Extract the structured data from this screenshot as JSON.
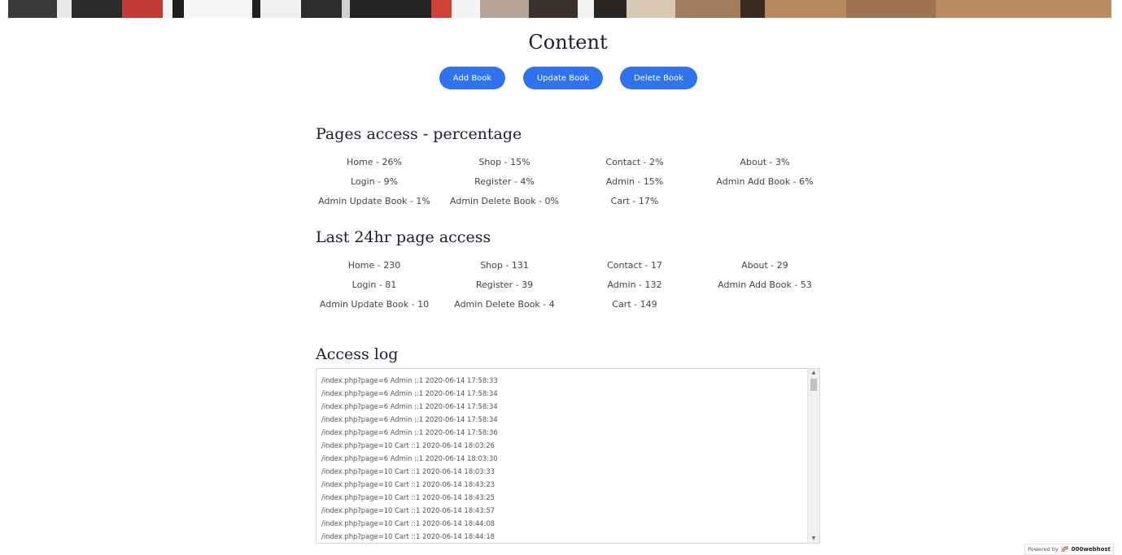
{
  "content": {
    "title": "Content",
    "buttons": {
      "add": "Add Book",
      "update": "Update Book",
      "delete": "Delete Book"
    }
  },
  "pages_access": {
    "title": "Pages access - percentage",
    "items": [
      "Home - 26%",
      "Shop - 15%",
      "Contact - 2%",
      "About - 3%",
      "Login - 9%",
      "Register - 4%",
      "Admin - 15%",
      "Admin Add Book - 6%",
      "Admin Update Book - 1%",
      "Admin Delete Book - 0%",
      "Cart - 17%"
    ]
  },
  "last_24hr": {
    "title": "Last 24hr page access",
    "items": [
      "Home - 230",
      "Shop - 131",
      "Contact - 17",
      "About - 29",
      "Login - 81",
      "Register - 39",
      "Admin - 132",
      "Admin Add Book - 53",
      "Admin Update Book - 10",
      "Admin Delete Book - 4",
      "Cart - 149"
    ]
  },
  "access_log": {
    "title": "Access log",
    "lines": [
      "/index.php?page=6 Admin ::1 2020-06-14 17:58:33",
      "/index.php?page=6 Admin ::1 2020-06-14 17:58:34",
      "/index.php?page=6 Admin ::1 2020-06-14 17:58:34",
      "/index.php?page=6 Admin ::1 2020-06-14 17:58:34",
      "/index.php?page=6 Admin ::1 2020-06-14 17:58:36",
      "/index.php?page=10 Cart ::1 2020-06-14 18:03:26",
      "/index.php?page=6 Admin ::1 2020-06-14 18:03:30",
      "/index.php?page=10 Cart ::1 2020-06-14 18:03:33",
      "/index.php?page=10 Cart ::1 2020-06-14 18:43:23",
      "/index.php?page=10 Cart ::1 2020-06-14 18:43:25",
      "/index.php?page=10 Cart ::1 2020-06-14 18:43:57",
      "/index.php?page=10 Cart ::1 2020-06-14 18:44:08",
      "/index.php?page=10 Cart ::1 2020-06-14 18:44:18"
    ]
  },
  "footer": {
    "powered_by": "Powered by",
    "host": "000webhost"
  },
  "colors": {
    "button": "#2f73f0",
    "heading": "#1a1f2e"
  }
}
